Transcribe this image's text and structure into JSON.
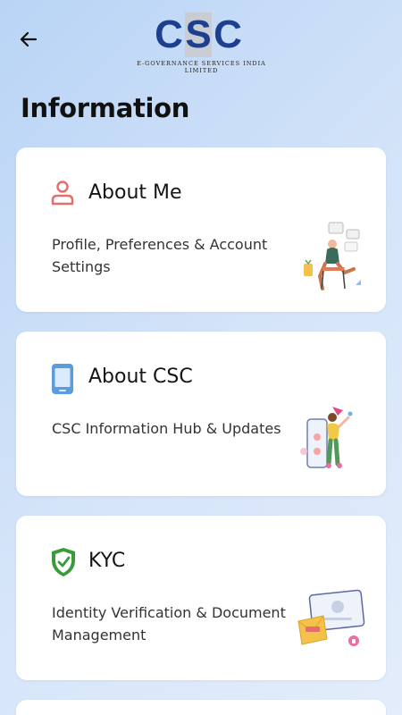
{
  "header": {
    "back_icon": "arrow-left-icon",
    "logo": {
      "letters": [
        "C",
        "S",
        "C"
      ],
      "subtitle": "E-Governance Services India Limited"
    }
  },
  "page": {
    "title": "Information"
  },
  "cards": [
    {
      "icon": "user-icon",
      "icon_color": "#e46d6d",
      "title": "About Me",
      "description": "Profile, Preferences & Account Settings"
    },
    {
      "icon": "mobile-icon",
      "icon_color": "#5b9be0",
      "title": "About CSC",
      "description": "CSC Information Hub & Updates"
    },
    {
      "icon": "shield-check-icon",
      "icon_color": "#3a9b3a",
      "title": "KYC",
      "description": "Identity Verification & Document Management"
    }
  ],
  "colors": {
    "background_start": "#b9d4f6",
    "background_end": "#e3edfb",
    "card": "#ffffff",
    "logo_blue": "#1d3f8f"
  }
}
